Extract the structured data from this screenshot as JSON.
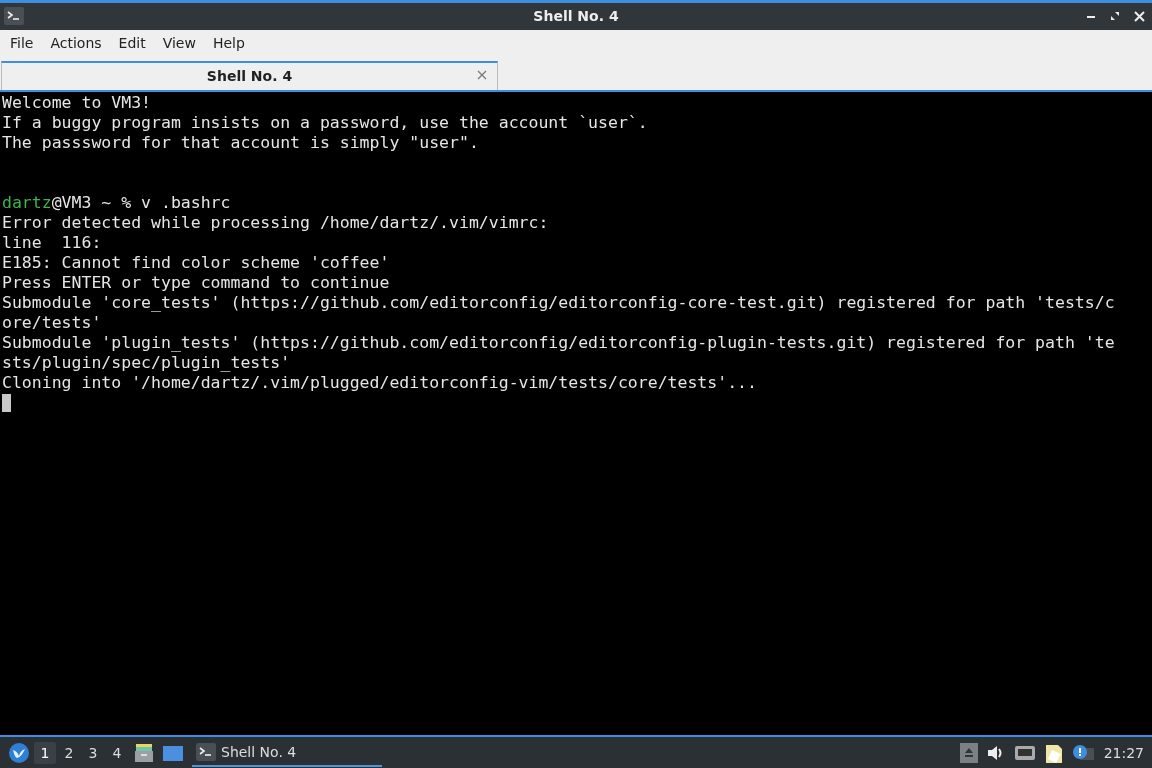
{
  "window": {
    "title": "Shell No. 4"
  },
  "menu": [
    "File",
    "Actions",
    "Edit",
    "View",
    "Help"
  ],
  "tabs": [
    {
      "label": "Shell No. 4",
      "selected": true
    }
  ],
  "terminal": {
    "lines": [
      {
        "kind": "text",
        "text": "Welcome to VM3!"
      },
      {
        "kind": "text",
        "text": "If a buggy program insists on a password, use the account `user`."
      },
      {
        "kind": "text",
        "text": "The passsword for that account is simply \"user\"."
      },
      {
        "kind": "blank"
      },
      {
        "kind": "blank"
      },
      {
        "kind": "prompt",
        "user": "dartz",
        "text": "@VM3 ~ % v .bashrc"
      },
      {
        "kind": "text",
        "text": "Error detected while processing /home/dartz/.vim/vimrc:"
      },
      {
        "kind": "text",
        "text": "line  116:"
      },
      {
        "kind": "text",
        "text": "E185: Cannot find color scheme 'coffee'"
      },
      {
        "kind": "text",
        "text": "Press ENTER or type command to continue"
      },
      {
        "kind": "text",
        "text": "Submodule 'core_tests' (https://github.com/editorconfig/editorconfig-core-test.git) registered for path 'tests/c"
      },
      {
        "kind": "text",
        "text": "ore/tests'"
      },
      {
        "kind": "text",
        "text": "Submodule 'plugin_tests' (https://github.com/editorconfig/editorconfig-plugin-tests.git) registered for path 'te"
      },
      {
        "kind": "text",
        "text": "sts/plugin/spec/plugin_tests'"
      },
      {
        "kind": "text",
        "text": "Cloning into '/home/dartz/.vim/plugged/editorconfig-vim/tests/core/tests'..."
      },
      {
        "kind": "cursor"
      }
    ]
  },
  "taskbar": {
    "workspaces": [
      {
        "label": "1",
        "selected": true
      },
      {
        "label": "2",
        "selected": false
      },
      {
        "label": "3",
        "selected": false
      },
      {
        "label": "4",
        "selected": false
      }
    ],
    "tasks": [
      {
        "label": "Shell No. 4",
        "selected": true
      }
    ],
    "clock": "21:27"
  }
}
